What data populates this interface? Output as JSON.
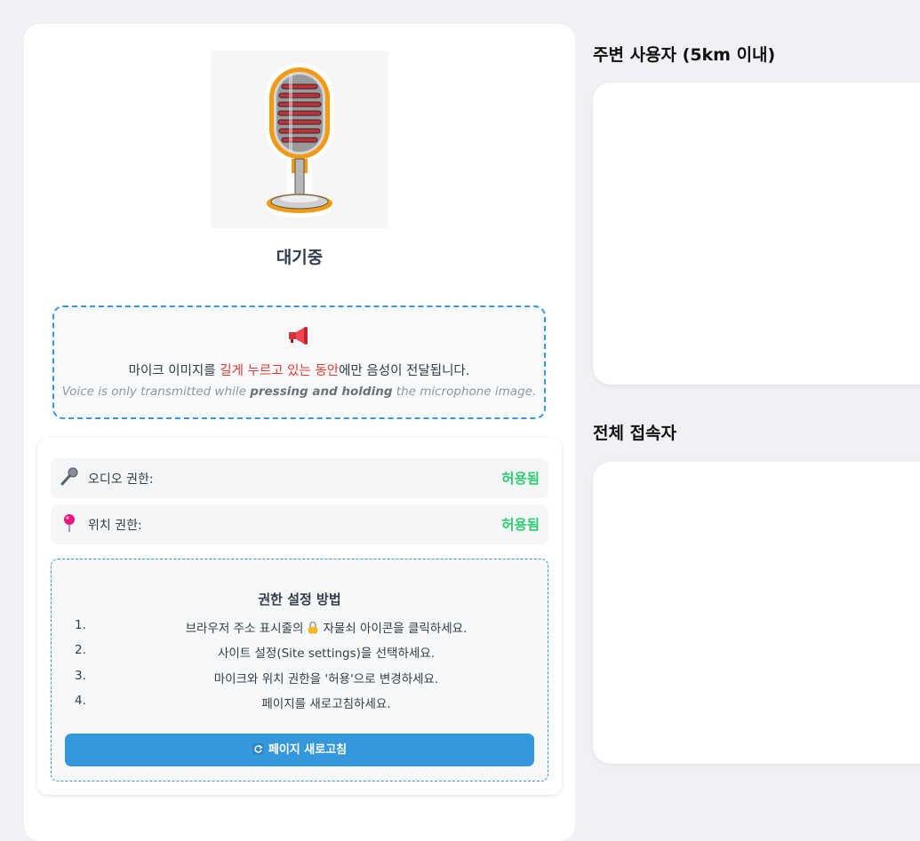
{
  "status": "대기중",
  "notice": {
    "megaphone_icon": "megaphone-icon",
    "ko_prefix": "마이크 이미지를 ",
    "ko_highlight": "길게 누르고 있는 동안",
    "ko_suffix": "에만 음성이 전달됩니다.",
    "en_prefix": "Voice is only transmitted while ",
    "en_bold": "pressing and holding",
    "en_suffix": " the microphone image.",
    "highlight_color": "#e33a2c"
  },
  "permissions": {
    "audio": {
      "icon": "microphone-icon",
      "label": "오디오 권한:",
      "value": "허용됨"
    },
    "location": {
      "icon": "pushpin-icon",
      "label": "위치 권한:",
      "value": "허용됨"
    },
    "granted_color": "#2ecc71"
  },
  "howto": {
    "title": "권한 설정 방법",
    "steps": [
      {
        "num": "1.",
        "before": "브라우저 주소 표시줄의",
        "icon": "lock-icon",
        "after": "자물쇠 아이콘을 클릭하세요."
      },
      {
        "num": "2.",
        "text": "사이트 설정(Site settings)을 선택하세요."
      },
      {
        "num": "3.",
        "text": "마이크와 위치 권한을 '허용'으로 변경하세요."
      },
      {
        "num": "4.",
        "text": "페이지를 새로고침하세요."
      }
    ],
    "reload_icon": "reload-icon",
    "reload_label": "페이지 새로고침",
    "accent_color": "#3498db"
  },
  "nearby": {
    "title": "주변 사용자 (5km 이내)"
  },
  "all_users": {
    "title": "전체 접속자"
  }
}
